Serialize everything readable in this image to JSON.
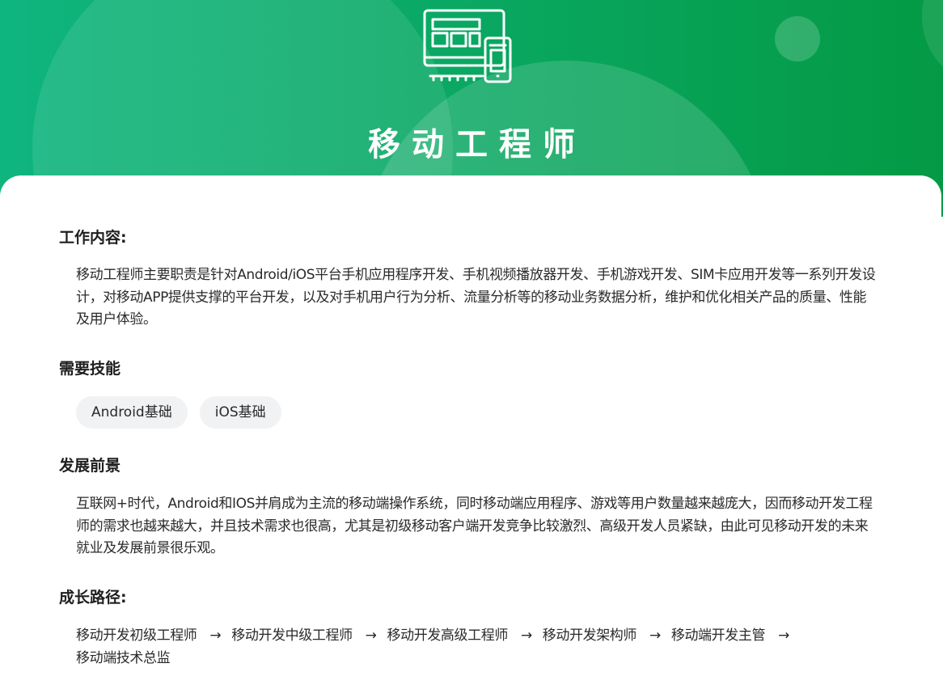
{
  "header": {
    "title": "移动工程师",
    "icon": "devices-icon",
    "gradient_start": "#0fb57f",
    "gradient_end": "#049a45"
  },
  "job_content": {
    "title": "工作内容:",
    "text": "移动工程师主要职责是针对Android/iOS平台手机应用程序开发、手机视频播放器开发、手机游戏开发、SIM卡应用开发等一系列开发设计，对移动APP提供支撑的平台开发，以及对手机用户行为分析、流量分析等的移动业务数据分析，维护和优化相关产品的质量、性能及用户体验。"
  },
  "skills": {
    "title": "需要技能",
    "items": [
      "Android基础",
      "iOS基础"
    ]
  },
  "prospects": {
    "title": "发展前景",
    "text": "互联网+时代，Android和IOS并肩成为主流的移动端操作系统，同时移动端应用程序、游戏等用户数量越来越庞大，因而移动开发工程师的需求也越来越大，并且技术需求也很高，尤其是初级移动客户端开发竞争比较激烈、高级开发人员紧缺，由此可见移动开发的未来就业及发展前景很乐观。"
  },
  "growth_path": {
    "title": "成长路径:",
    "arrow": "→",
    "steps": [
      "移动开发初级工程师",
      "移动开发中级工程师",
      "移动开发高级工程师",
      "移动开发架构师",
      "移动端开发主管",
      "移动端技术总监"
    ]
  }
}
